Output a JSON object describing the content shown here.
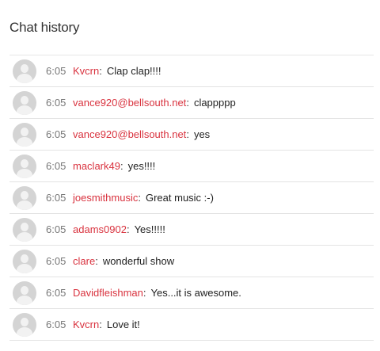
{
  "header": {
    "title": "Chat history"
  },
  "messages": [
    {
      "time": "6:05",
      "user": "Kvcrn",
      "text": "Clap clap!!!!"
    },
    {
      "time": "6:05",
      "user": "vance920@bellsouth.net",
      "text": "clappppp"
    },
    {
      "time": "6:05",
      "user": "vance920@bellsouth.net",
      "text": "yes"
    },
    {
      "time": "6:05",
      "user": "maclark49",
      "text": "yes!!!!"
    },
    {
      "time": "6:05",
      "user": "joesmithmusic",
      "text": "Great music :-)"
    },
    {
      "time": "6:05",
      "user": "adams0902",
      "text": "Yes!!!!!"
    },
    {
      "time": "6:05",
      "user": "clare",
      "text": "wonderful show"
    },
    {
      "time": "6:05",
      "user": "Davidfleishman",
      "text": "Yes...it is awesome."
    },
    {
      "time": "6:05",
      "user": "Kvcrn",
      "text": "Love it!"
    }
  ],
  "colors": {
    "username": "#d9333f",
    "time": "#777777",
    "avatar": "#d4d4d4"
  },
  "icons": {
    "avatar": "default-user-avatar-icon"
  }
}
